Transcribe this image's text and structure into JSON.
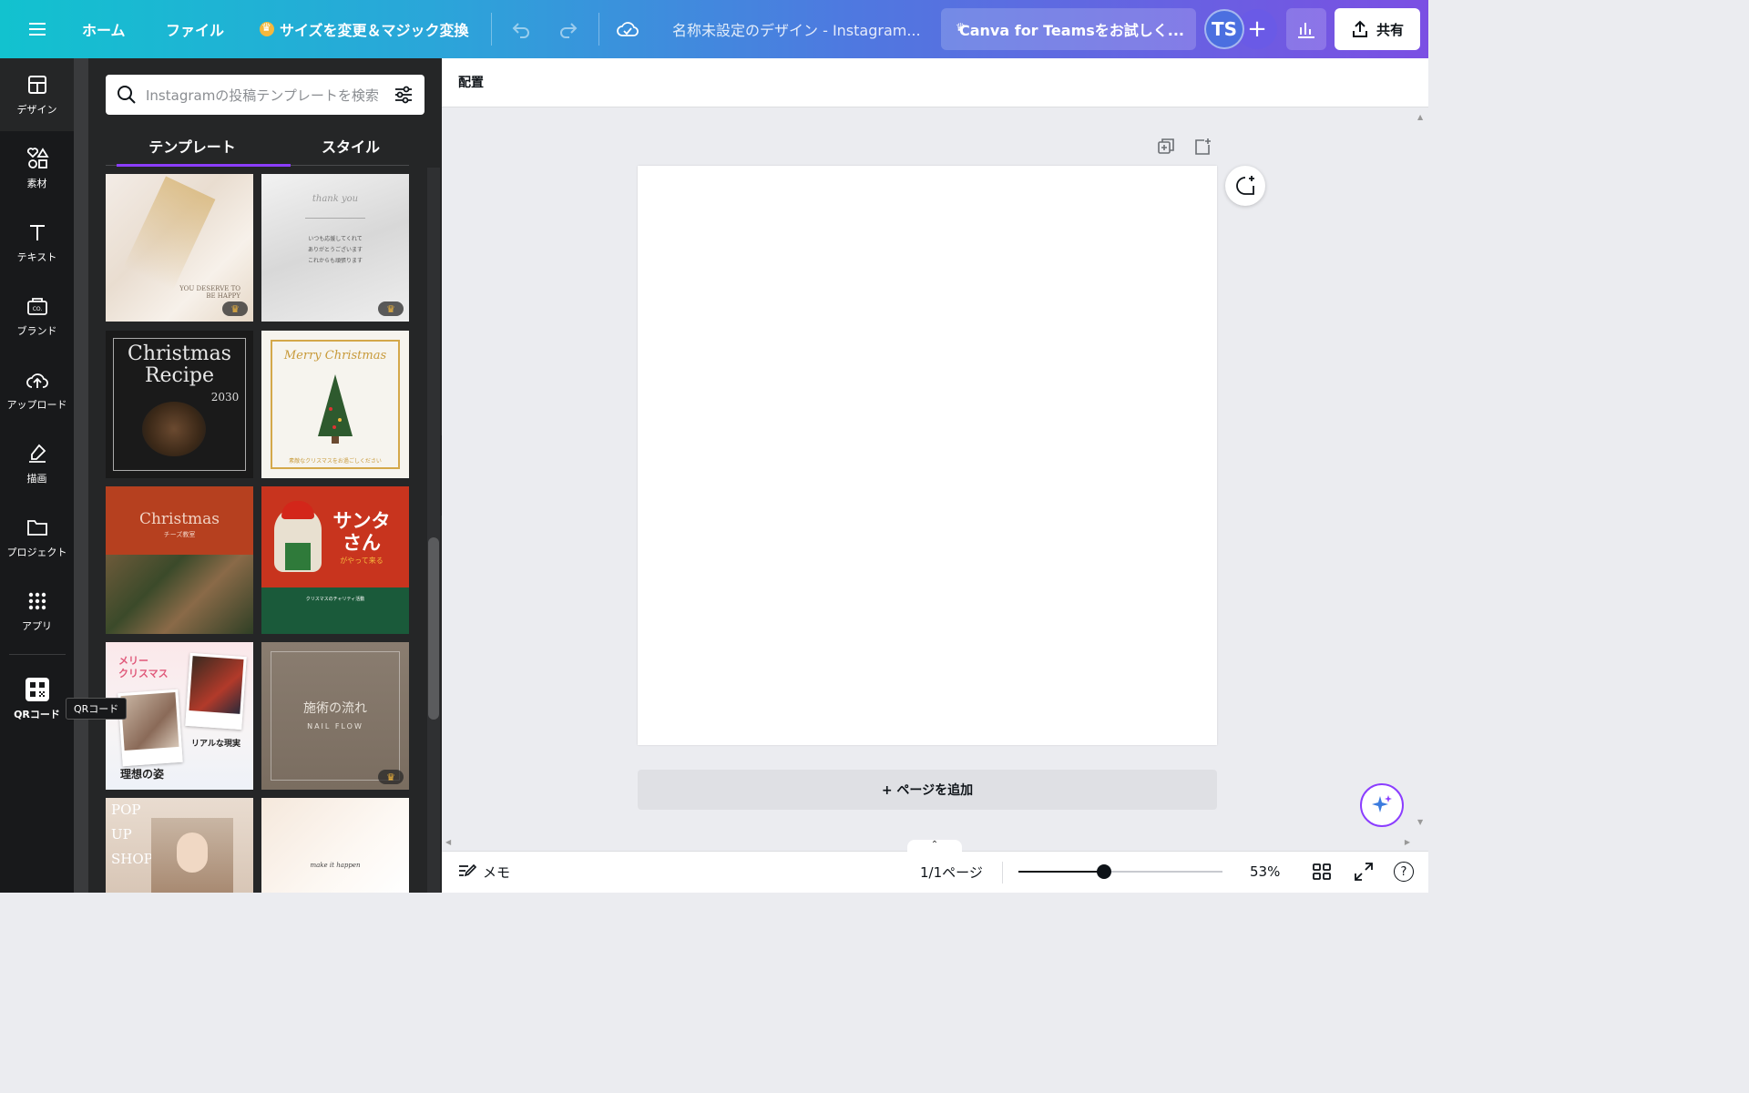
{
  "topbar": {
    "home": "ホーム",
    "file": "ファイル",
    "resize": "サイズを変更＆マジック変換",
    "doc_title": "名称未設定のデザイン - Instagram...",
    "teams": "Canva for Teamsをお試しく...",
    "avatar_initials": "TS",
    "plus": "+",
    "share": "共有"
  },
  "sidebar": {
    "items": [
      {
        "label": "デザイン",
        "icon": "layout-icon"
      },
      {
        "label": "素材",
        "icon": "shapes-icon"
      },
      {
        "label": "テキスト",
        "icon": "text-icon"
      },
      {
        "label": "ブランド",
        "icon": "brand-icon"
      },
      {
        "label": "アップロード",
        "icon": "cloud-upload-icon"
      },
      {
        "label": "描画",
        "icon": "draw-icon"
      },
      {
        "label": "プロジェクト",
        "icon": "folder-icon"
      },
      {
        "label": "アプリ",
        "icon": "apps-grid-icon"
      },
      {
        "label": "QRコード",
        "icon": "qr-code-icon"
      }
    ],
    "tooltip": "QRコード"
  },
  "panel": {
    "search_placeholder": "Instagramの投稿テンプレートを検索",
    "tabs": [
      "テンプレート",
      "スタイル"
    ],
    "templates": [
      {
        "lines": [
          "YOU DESERVE TO",
          "BE HAPPY"
        ],
        "premium": true
      },
      {
        "lines": [
          "thank you",
          "いつも応援してくれて",
          "ありがとうございます",
          "これからも頑張ります"
        ],
        "premium": true
      },
      {
        "lines": [
          "Christmas",
          "Recipe",
          "2030"
        ],
        "premium": false
      },
      {
        "lines": [
          "Merry Christmas",
          "素敵なクリスマスをお過ごしください"
        ],
        "premium": false
      },
      {
        "lines": [
          "Christmas",
          "チーズ教室"
        ],
        "premium": false
      },
      {
        "lines": [
          "サンタ",
          "さん",
          "がやって来る",
          "クリスマスのチャリティ活動"
        ],
        "premium": false
      },
      {
        "lines": [
          "メリー",
          "クリスマス",
          "リアルな現実",
          "理想の姿"
        ],
        "premium": false
      },
      {
        "lines": [
          "施術の流れ",
          "NAIL FLOW"
        ],
        "premium": true
      },
      {
        "lines": [
          "POP",
          "UP",
          "SHOP"
        ],
        "premium": false
      },
      {
        "lines": [
          "make it happen"
        ],
        "premium": false
      }
    ]
  },
  "editor": {
    "context_label": "配置",
    "add_page": "+ ページを追加",
    "memo": "メモ",
    "page_indicator": "1/1ページ",
    "zoom": "53%",
    "zoom_level": 0.42,
    "help": "?"
  },
  "colors": {
    "accent": "#8b3dff",
    "premium": "#f5b83d"
  }
}
